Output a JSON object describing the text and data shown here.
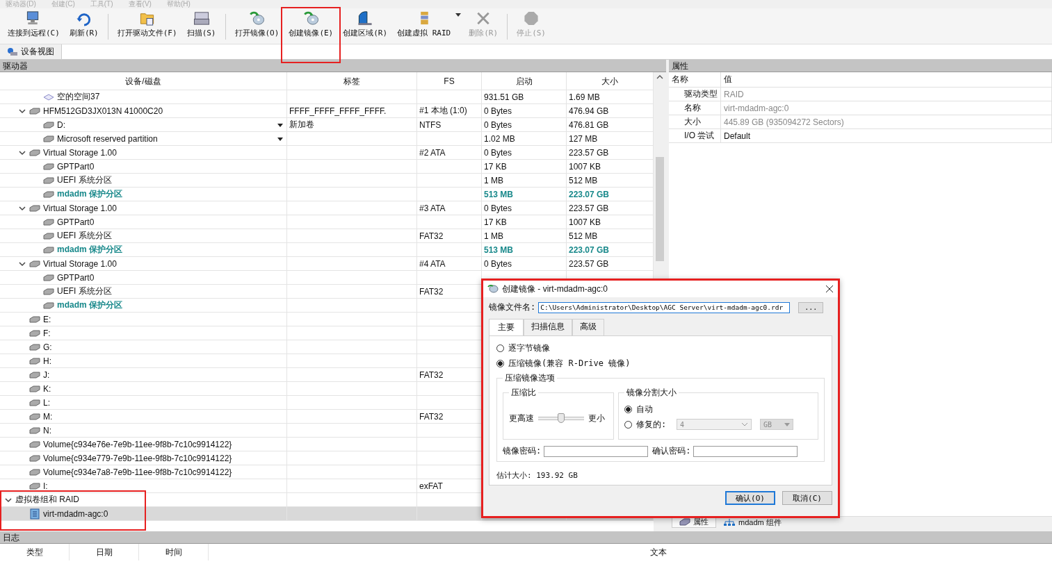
{
  "menu": [
    "驱动器(D)",
    "创建(C)",
    "工具(T)",
    "查看(V)",
    "帮助(H)"
  ],
  "toolbar": [
    {
      "buttons": [
        {
          "label": "连接到远程(C)",
          "disabled": false,
          "highlighted": false
        },
        {
          "label": "刷新(R)",
          "disabled": false,
          "highlighted": false
        }
      ]
    },
    {
      "buttons": [
        {
          "label": "打开驱动文件(F)",
          "disabled": false,
          "highlighted": false
        },
        {
          "label": "扫描(S)",
          "disabled": false,
          "highlighted": false
        }
      ]
    },
    {
      "buttons": [
        {
          "label": "打开镜像(O)",
          "disabled": false,
          "highlighted": false
        },
        {
          "label": "创建镜像(E)",
          "disabled": false,
          "highlighted": true
        },
        {
          "label": "创建区域(R)",
          "disabled": false,
          "highlighted": false
        },
        {
          "label": "创建虚拟 RAID",
          "disabled": false,
          "dropdown": true
        },
        {
          "label": "删除(R)",
          "disabled": true,
          "highlighted": false
        }
      ]
    },
    {
      "buttons": [
        {
          "label": "停止(S)",
          "disabled": true,
          "highlighted": false
        }
      ]
    }
  ],
  "view_tabs": [
    {
      "label": "设备视图",
      "selected": true
    }
  ],
  "drives_panel": {
    "title": "驱动器",
    "columns": [
      "设备/磁盘",
      "标签",
      "FS",
      "启动",
      "大小"
    ],
    "rows": [
      {
        "kind": "free",
        "name": "空的空间37",
        "start": "931.51 GB",
        "size": "1.69 MB"
      },
      {
        "kind": "disk",
        "name": "HFM512GD3JX013N 41000C20",
        "label": "FFFF_FFFF_FFFF_FFFF.",
        "fs": "#1 本地 (1:0)",
        "start": "0 Bytes",
        "size": "476.94 GB",
        "expanded": true,
        "children": [
          {
            "kind": "partition",
            "name": "D:",
            "label": "新加卷",
            "fs": "NTFS",
            "start": "0 Bytes",
            "size": "476.81 GB",
            "has_menu": true
          },
          {
            "kind": "partition",
            "name": "Microsoft reserved partition",
            "start": "1.02 MB",
            "size": "127 MB",
            "has_menu": true
          }
        ]
      },
      {
        "kind": "disk",
        "name": "Virtual Storage 1.00",
        "fs": "#2 ATA",
        "start": "0 Bytes",
        "size": "223.57 GB",
        "expanded": true,
        "children": [
          {
            "kind": "partition",
            "name": "GPTPart0",
            "start": "17 KB",
            "size": "1007 KB"
          },
          {
            "kind": "partition",
            "name": "UEFI 系统分区",
            "start": "1 MB",
            "size": "512 MB"
          },
          {
            "kind": "partition",
            "name": "mdadm 保护分区",
            "start": "513 MB",
            "size": "223.07 GB",
            "emphasis": true
          }
        ]
      },
      {
        "kind": "disk",
        "name": "Virtual Storage 1.00",
        "fs": "#3 ATA",
        "start": "0 Bytes",
        "size": "223.57 GB",
        "expanded": true,
        "children": [
          {
            "kind": "partition",
            "name": "GPTPart0",
            "start": "17 KB",
            "size": "1007 KB"
          },
          {
            "kind": "partition",
            "name": "UEFI 系统分区",
            "fs": "FAT32",
            "start": "1 MB",
            "size": "512 MB"
          },
          {
            "kind": "partition",
            "name": "mdadm 保护分区",
            "start": "513 MB",
            "size": "223.07 GB",
            "emphasis": true
          }
        ]
      },
      {
        "kind": "disk",
        "name": "Virtual Storage 1.00",
        "fs": "#4 ATA",
        "start": "0 Bytes",
        "size": "223.57 GB",
        "expanded": true,
        "children": [
          {
            "kind": "partition",
            "name": "GPTPart0"
          },
          {
            "kind": "partition",
            "name": "UEFI 系统分区",
            "fs": "FAT32"
          },
          {
            "kind": "partition",
            "name": "mdadm 保护分区",
            "emphasis": true
          }
        ]
      },
      {
        "kind": "volume",
        "name": "E:"
      },
      {
        "kind": "volume",
        "name": "F:"
      },
      {
        "kind": "volume",
        "name": "G:"
      },
      {
        "kind": "volume",
        "name": "H:"
      },
      {
        "kind": "volume",
        "name": "J:",
        "fs": "FAT32"
      },
      {
        "kind": "volume",
        "name": "K:"
      },
      {
        "kind": "volume",
        "name": "L:"
      },
      {
        "kind": "volume",
        "name": "M:",
        "fs": "FAT32"
      },
      {
        "kind": "volume",
        "name": "N:"
      },
      {
        "kind": "volume",
        "name": "Volume{c934e76e-7e9b-11ee-9f8b-7c10c9914122}"
      },
      {
        "kind": "volume",
        "name": "Volume{c934e779-7e9b-11ee-9f8b-7c10c9914122}"
      },
      {
        "kind": "volume",
        "name": "Volume{c934e7a8-7e9b-11ee-9f8b-7c10c9914122}"
      },
      {
        "kind": "volume",
        "name": "I:",
        "fs": "exFAT"
      },
      {
        "kind": "group",
        "name": "虚拟卷组和 RAID",
        "expanded": true,
        "highlighted": true,
        "children": [
          {
            "kind": "raid",
            "name": "virt-mdadm-agc:0",
            "selected": true
          }
        ]
      }
    ]
  },
  "properties_panel": {
    "title": "属性",
    "columns": [
      "名称",
      "值"
    ],
    "rows": [
      {
        "name": "驱动类型",
        "value": "RAID",
        "readonly": true
      },
      {
        "name": "名称",
        "value": "virt-mdadm-agc:0",
        "readonly": true
      },
      {
        "name": "大小",
        "value": "445.89 GB (935094272 Sectors)",
        "readonly": true
      },
      {
        "name": "I/O 尝试",
        "value": "Default",
        "readonly": false
      }
    ],
    "tabs": [
      {
        "label": "属性",
        "selected": true
      },
      {
        "label": "mdadm 组件",
        "selected": false
      }
    ]
  },
  "log_panel": {
    "title": "日志",
    "columns": [
      "类型",
      "日期",
      "时间",
      "文本"
    ]
  },
  "dialog": {
    "title": "创建镜像 - virt-mdadm-agc:0",
    "highlighted": true,
    "file_label": "镜像文件名:",
    "file_value": "C:\\Users\\Administrator\\Desktop\\AGC Server\\virt-mdadm-agc0.rdr",
    "browse": "...",
    "tabs": [
      {
        "label": "主要",
        "selected": true
      },
      {
        "label": "扫描信息",
        "selected": false
      },
      {
        "label": "高级",
        "selected": false
      }
    ],
    "modes": [
      {
        "label": "逐字节镜像",
        "selected": false
      },
      {
        "label": "压缩镜像(兼容 R-Drive 镜像)",
        "selected": true
      }
    ],
    "options_title": "压缩镜像选项",
    "ratio": {
      "title": "压缩比",
      "left": "更高速",
      "right": "更小",
      "level": 0.5
    },
    "split": {
      "title": "镜像分割大小",
      "choices": [
        {
          "label": "自动",
          "selected": true
        },
        {
          "label": "修复的:",
          "selected": false
        }
      ],
      "value": "4",
      "unit": "GB",
      "disabled": true
    },
    "password_label": "镜像密码:",
    "confirm_label": "确认密码:",
    "estimate": "估计大小: 193.92 GB",
    "buttons": [
      {
        "label": "确认(O)",
        "default": true
      },
      {
        "label": "取消(C)",
        "default": false
      }
    ]
  }
}
